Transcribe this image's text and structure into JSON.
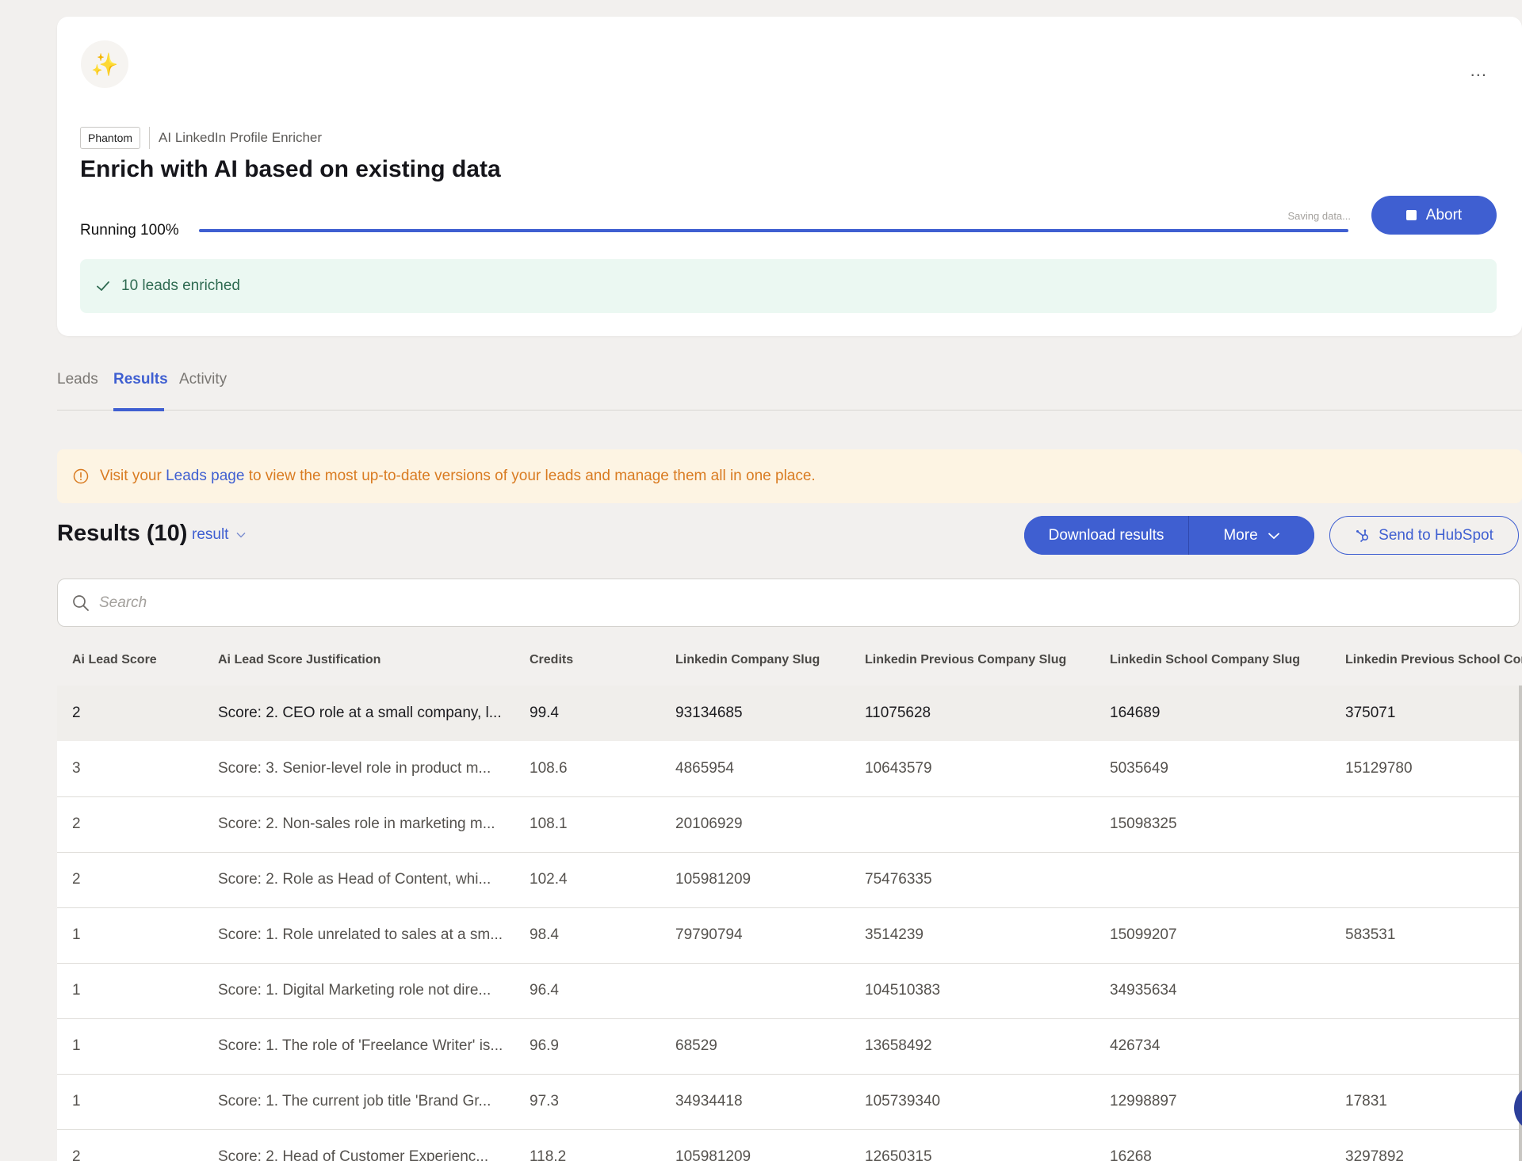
{
  "header": {
    "tag": "Phantom",
    "phantom_name": "AI LinkedIn Profile Enricher",
    "title": "Enrich with AI based on existing data",
    "run_status": "Running 100%",
    "progress_percent": 100,
    "saving_text": "Saving data...",
    "abort_label": "Abort",
    "success_text": "10 leads enriched",
    "more_label": "..."
  },
  "tabs": [
    {
      "label": "Leads",
      "active": false
    },
    {
      "label": "Results",
      "active": true
    },
    {
      "label": "Activity",
      "active": false
    }
  ],
  "notice": {
    "prefix": "Visit your",
    "link": "Leads page",
    "suffix": "to view the most up-to-date versions of your leads and manage them all in one place."
  },
  "results": {
    "title": "Results (10)",
    "select_value": "result",
    "download_label": "Download results",
    "more_label": "More",
    "hubspot_label": "Send to HubSpot",
    "search_placeholder": "Search"
  },
  "table": {
    "columns": [
      "Ai Lead Score",
      "Ai Lead Score Justification",
      "Credits",
      "Linkedin Company Slug",
      "Linkedin Previous Company Slug",
      "Linkedin School Company Slug",
      "Linkedin Previous School Company Slug"
    ],
    "rows": [
      [
        "2",
        "Score: 2. CEO role at a small company, l...",
        "99.4",
        "93134685",
        "11075628",
        "164689",
        "375071"
      ],
      [
        "3",
        "Score: 3. Senior-level role in product m...",
        "108.6",
        "4865954",
        "10643579",
        "5035649",
        "15129780"
      ],
      [
        "2",
        "Score: 2. Non-sales role in marketing m...",
        "108.1",
        "20106929",
        "",
        "15098325",
        ""
      ],
      [
        "2",
        "Score: 2. Role as Head of Content, whi...",
        "102.4",
        "105981209",
        "75476335",
        "",
        ""
      ],
      [
        "1",
        "Score: 1. Role unrelated to sales at a sm...",
        "98.4",
        "79790794",
        "3514239",
        "15099207",
        "583531"
      ],
      [
        "1",
        "Score: 1. Digital Marketing role not dire...",
        "96.4",
        "",
        "104510383",
        "34935634",
        ""
      ],
      [
        "1",
        "Score: 1. The role of 'Freelance Writer' is...",
        "96.9",
        "68529",
        "13658492",
        "426734",
        ""
      ],
      [
        "1",
        "Score: 1. The current job title 'Brand Gr...",
        "97.3",
        "34934418",
        "105739340",
        "12998897",
        "17831"
      ],
      [
        "2",
        "Score: 2. Head of Customer Experienc...",
        "118.2",
        "105981209",
        "12650315",
        "16268",
        "3297892"
      ]
    ]
  },
  "colors": {
    "accent": "#3f5fd1",
    "success_bg": "#ebf8f2",
    "notice_bg": "#fdf4e3",
    "notice_text": "#d97b21"
  }
}
